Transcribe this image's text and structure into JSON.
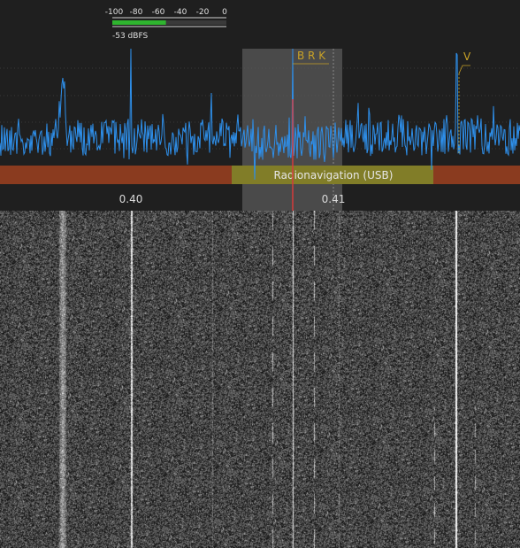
{
  "level_meter": {
    "scale_labels": [
      "-100",
      "-80",
      "-60",
      "-40",
      "-20",
      "0"
    ],
    "level_text": "-53 dBFS",
    "level_fraction": 0.47,
    "bar_color": "#2fb52f"
  },
  "frequency_axis": {
    "labels": [
      "0.40",
      "0.41"
    ]
  },
  "band_plan": {
    "band_color": "#8a3b1f",
    "segment_label": "Radionavigation (USB)",
    "segment_color": "#7f8a2a"
  },
  "markers": [
    {
      "label": "B R K"
    },
    {
      "label": "V"
    }
  ],
  "colors": {
    "background": "#1f1f1f",
    "trace": "#2e8fea",
    "marker_text": "#c9a227",
    "selection": "#5a5a5a",
    "tuning_line": "#d43b3b",
    "axis_text": "#d9d9d9"
  }
}
